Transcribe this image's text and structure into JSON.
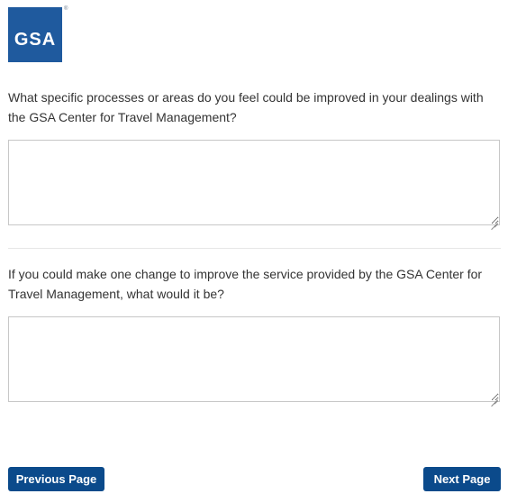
{
  "logo": {
    "text": "GSA",
    "registered_mark": "®",
    "brand_color": "#1f5a9e"
  },
  "questions": [
    {
      "text": "What specific processes or areas do you feel could be improved in your dealings with the GSA Center for Travel Management?",
      "answer_value": ""
    },
    {
      "text": "If you could make one change to improve the service provided by the GSA Center for Travel Management, what would it be?",
      "answer_value": ""
    }
  ],
  "navigation": {
    "previous_label": "Previous Page",
    "next_label": "Next Page",
    "button_color": "#0b4a8b"
  }
}
